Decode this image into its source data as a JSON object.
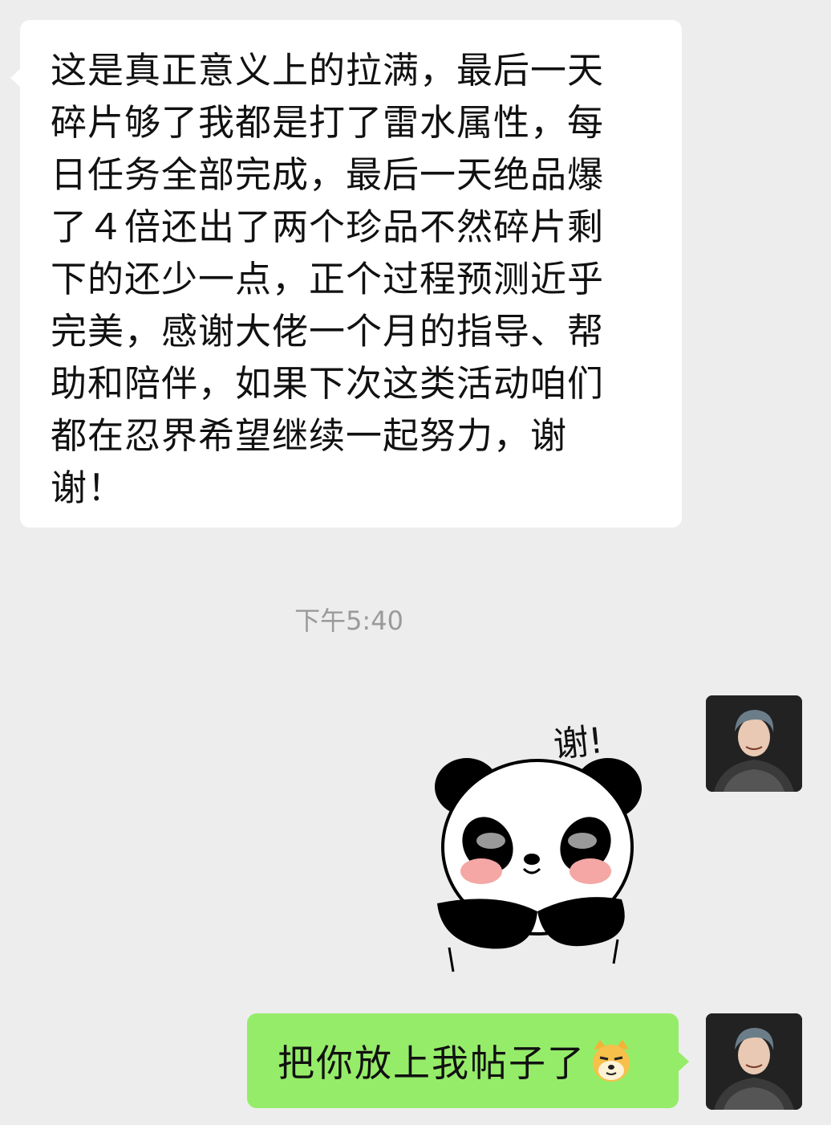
{
  "messages": {
    "incoming_text": "这是真正意义上的拉满，最后一天\n碎片够了我都是打了雷水属性，每\n日任务全部完成，最后一天绝品爆\n了４倍还出了两个珍品不然碎片剩\n下的还少一点，正个过程预测近乎\n完美，感谢大佬一个月的指导、帮\n助和陪伴，如果下次这类活动咱们\n都在忍界希望继续一起努力，谢\n谢！",
    "timestamp": "下午5:40",
    "sticker_text": "谢!",
    "outgoing_text": "把你放上我帖子了"
  },
  "icons": {
    "sticker": "panda-thank-you-sticker",
    "emoji": "doge-emoji",
    "avatar": "user-avatar"
  },
  "colors": {
    "background": "#ededed",
    "incoming_bubble": "#ffffff",
    "outgoing_bubble": "#95ec69",
    "timestamp": "#9a9a9a"
  }
}
